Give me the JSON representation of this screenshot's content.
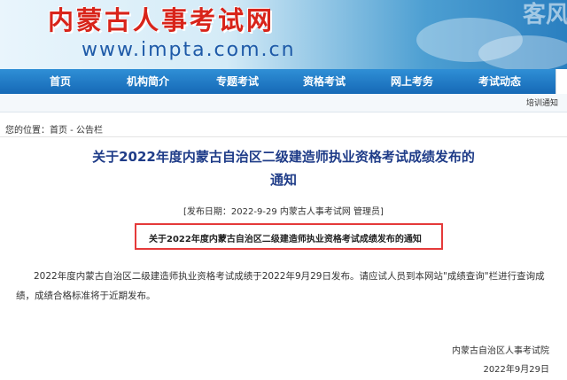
{
  "header": {
    "logo_text": "内蒙古人事考试网",
    "logo_url": "www.impta.com.cn",
    "deco_text": "客风"
  },
  "nav": {
    "items": [
      "首页",
      "机构简介",
      "专题考试",
      "资格考试",
      "网上考务",
      "考试动态"
    ]
  },
  "subbar": {
    "link": "培训通知"
  },
  "breadcrumb": {
    "prefix": "您的位置：",
    "home": "首页",
    "separator": " - ",
    "section": "公告栏"
  },
  "article": {
    "title_line1": "关于2022年度内蒙古自治区二级建造师执业资格考试成绩发布的",
    "title_line2": "通知",
    "meta": "[发布日期：2022-9-29 内蒙古人事考试网 管理员]",
    "boxed_title": "关于2022年度内蒙古自治区二级建造师执业资格考试成绩发布的通知",
    "body": "2022年度内蒙古自治区二级建造师执业资格考试成绩于2022年9月29日发布。请应试人员到本网站\"成绩查询\"栏进行查询成绩，成绩合格标准将于近期发布。",
    "signature": "内蒙古自治区人事考试院",
    "date": "2022年9月29日"
  },
  "colors": {
    "logo_red": "#d8241a",
    "nav_blue": "#1669b6",
    "title_blue": "#1f3c88",
    "highlight_red": "#e53a3a"
  }
}
